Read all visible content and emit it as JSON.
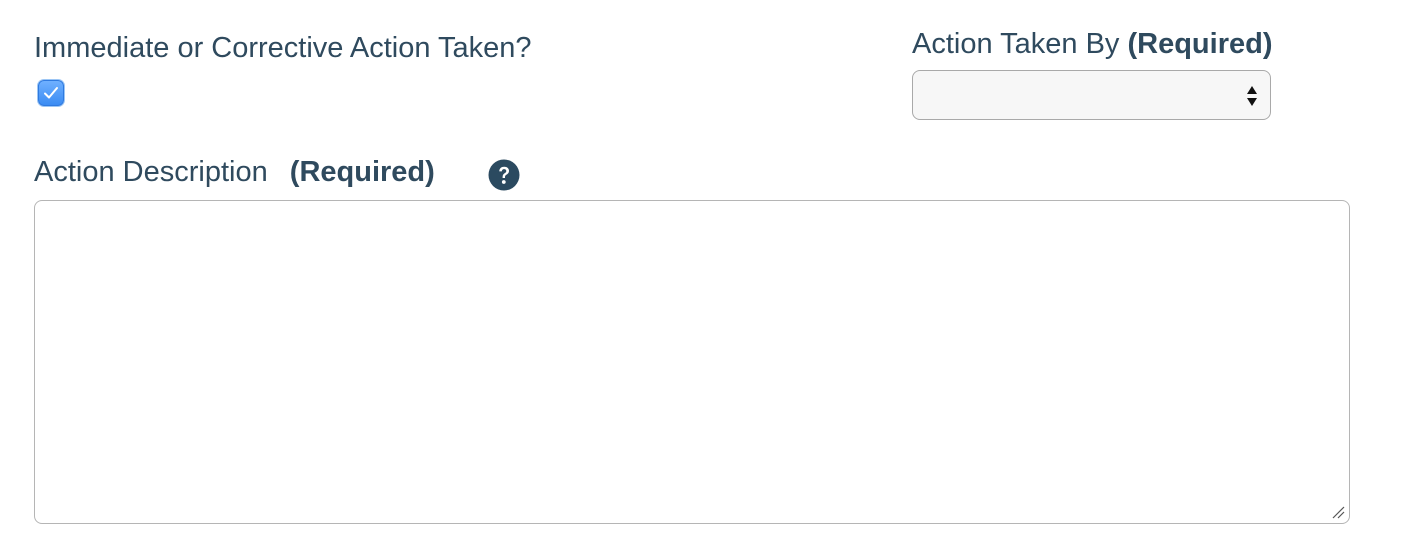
{
  "form": {
    "corrective_action": {
      "label": "Immediate or Corrective Action Taken?",
      "checked": true
    },
    "action_taken_by": {
      "label": "Action Taken By",
      "required_text": "(Required)",
      "selected_value": ""
    },
    "action_description": {
      "label": "Action Description",
      "required_text": "(Required)",
      "value": ""
    }
  },
  "icons": {
    "checkbox_check": "check-icon",
    "select_arrows": "up-down-arrows-icon",
    "help": "question-circle-icon",
    "resize": "resize-handle-icon"
  },
  "colors": {
    "label_text": "#2f4a5e",
    "checkbox_fill": "#3b8cf3",
    "help_icon": "#2b4a60",
    "select_background": "#f7f7f7",
    "border": "#a9a9a9"
  }
}
